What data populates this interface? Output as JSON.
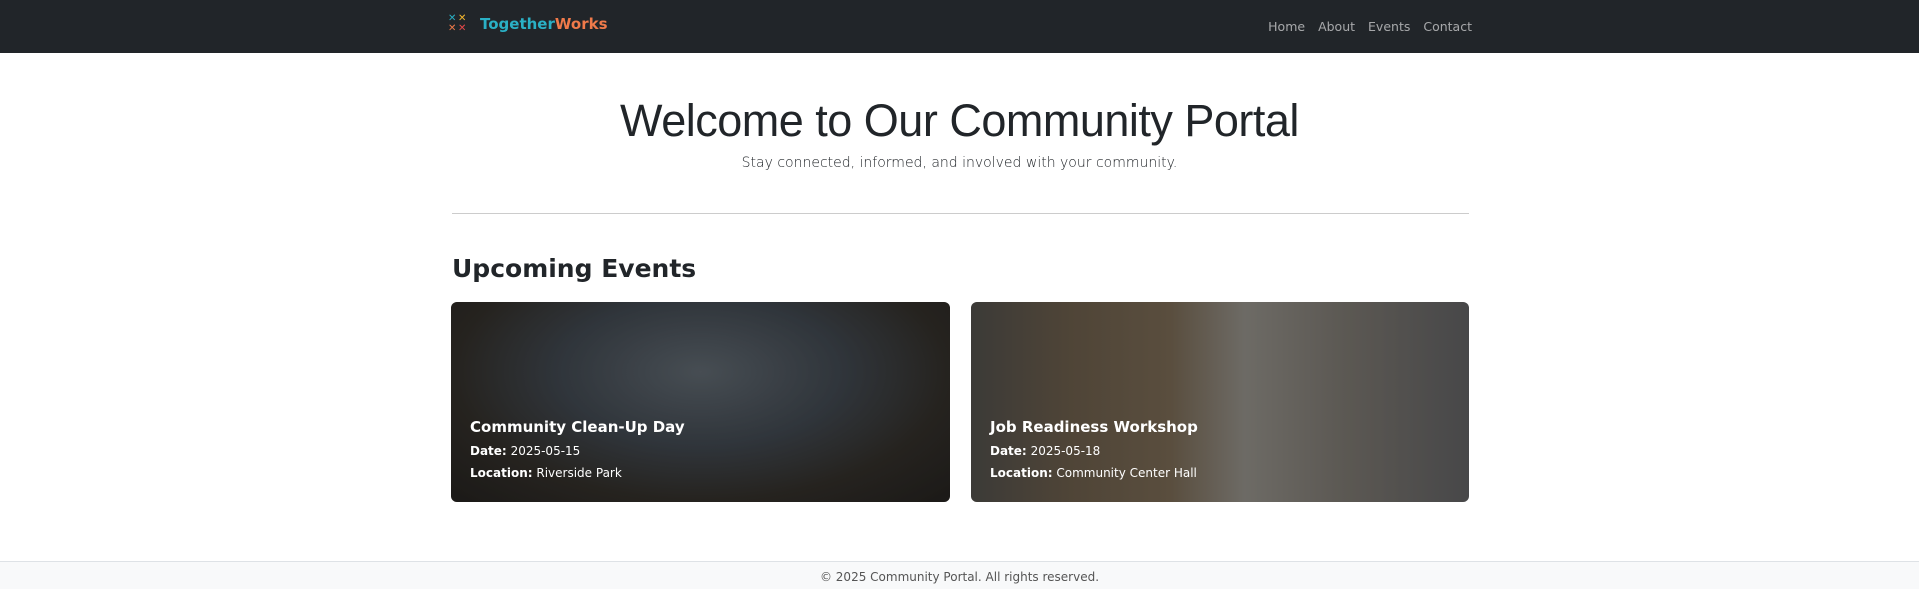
{
  "nav": {
    "brand_a": "Together",
    "brand_b": "Works",
    "links": [
      "Home",
      "About",
      "Events",
      "Contact"
    ],
    "colors": {
      "teal": "#2ab0c5",
      "orange": "#f07a4a"
    }
  },
  "hero": {
    "title": "Welcome to Our Community Portal",
    "subtitle": "Stay connected, informed, and involved with your community."
  },
  "events": {
    "heading": "Upcoming Events",
    "date_label": "Date:",
    "location_label": "Location:",
    "items": [
      {
        "title": "Community Clean-Up Day",
        "date": "2025-05-15",
        "location": "Riverside Park"
      },
      {
        "title": "Job Readiness Workshop",
        "date": "2025-05-18",
        "location": "Community Center Hall"
      }
    ]
  },
  "footer": {
    "text": "© 2025 Community Portal. All rights reserved."
  }
}
